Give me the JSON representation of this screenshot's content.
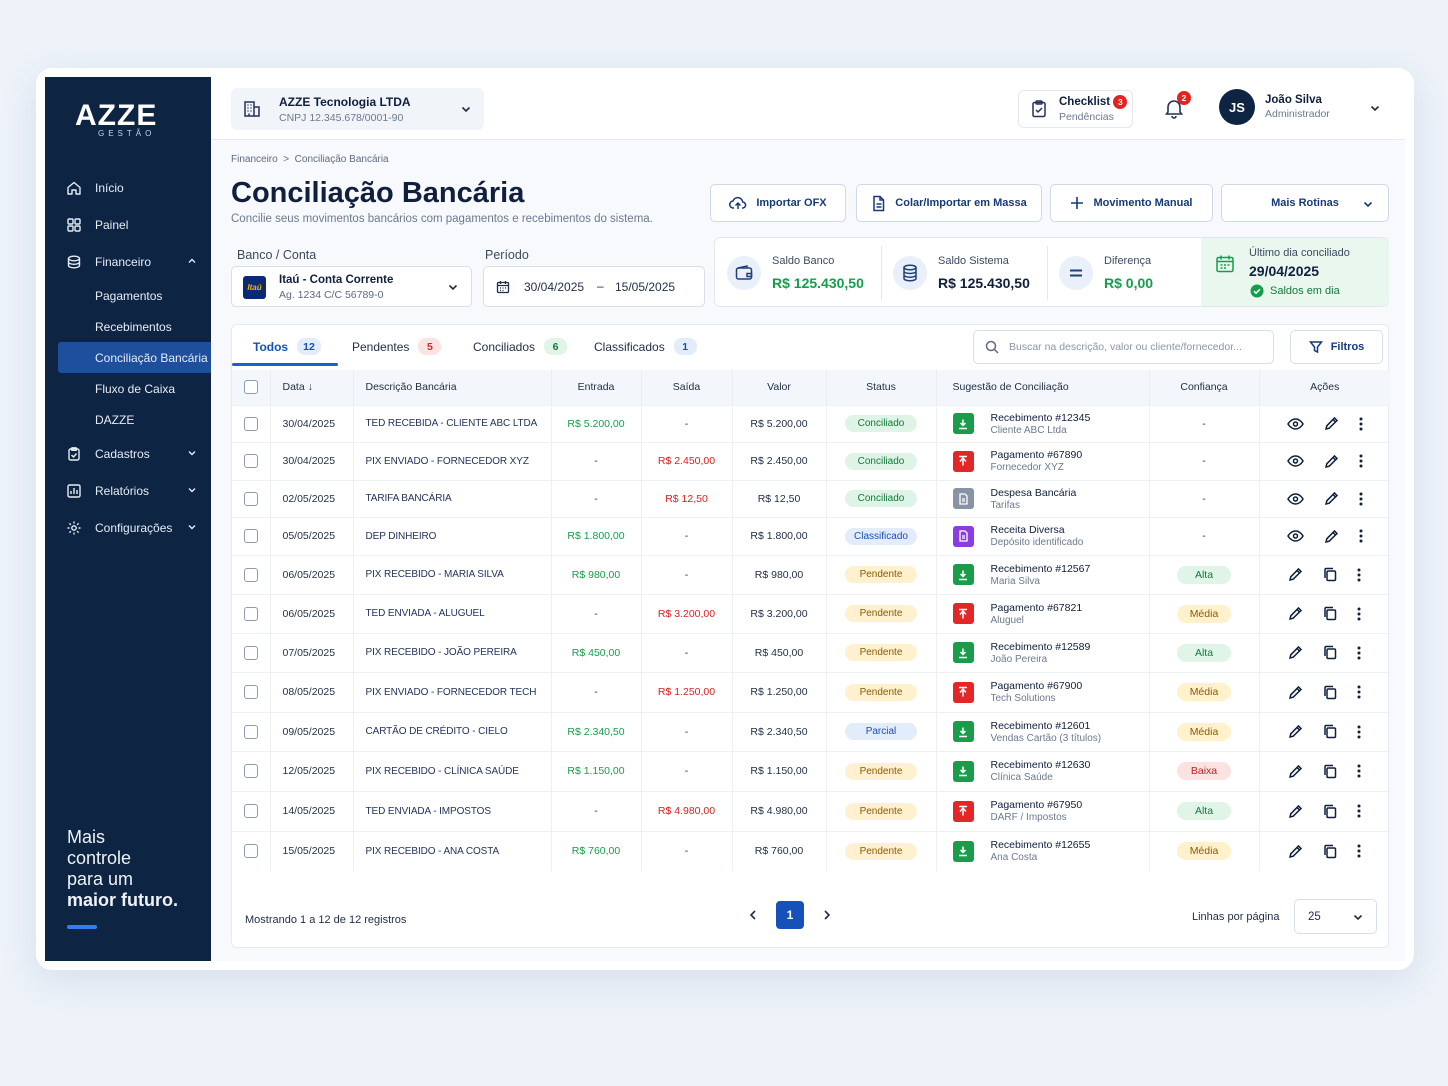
{
  "brand": {
    "logo": "AZZE",
    "logo_sub": "GESTÃO",
    "tagline_1": "Mais",
    "tagline_2": "controle",
    "tagline_3": "para um",
    "tagline_4": "maior futuro."
  },
  "sidebar": {
    "items": [
      {
        "label": "Início",
        "icon": "home-icon"
      },
      {
        "label": "Painel",
        "icon": "grid-icon"
      },
      {
        "label": "Financeiro",
        "icon": "coins-icon"
      }
    ],
    "financeiro_sub": [
      "Pagamentos",
      "Recebimentos",
      "Conciliação Bancária",
      "Fluxo de Caixa",
      "DAZZE"
    ],
    "items_after": [
      {
        "label": "Cadastros",
        "icon": "clipboard-icon"
      },
      {
        "label": "Relatórios",
        "icon": "chart-icon"
      },
      {
        "label": "Configurações",
        "icon": "gear-icon"
      }
    ]
  },
  "topbar": {
    "company_name": "AZZE Tecnologia LTDA",
    "company_cnpj": "CNPJ 12.345.678/0001-90",
    "checklist_title": "Checklist",
    "checklist_sub": "Pendências",
    "checklist_count": "3",
    "notif_count": "2",
    "user_initials": "JS",
    "user_name": "João Silva",
    "user_role": "Administrador"
  },
  "page": {
    "breadcrumb_1": "Financeiro",
    "breadcrumb_sep": ">",
    "breadcrumb_2": "Conciliação Bancária",
    "title": "Conciliação Bancária",
    "subtitle": "Concilie seus movimentos bancários com pagamentos e recebimentos do sistema."
  },
  "actions": {
    "import_ofx": "Importar OFX",
    "paste_import": "Colar/Importar em Massa",
    "manual": "Movimento Manual",
    "more": "Mais Rotinas"
  },
  "filters": {
    "bank_label": "Banco / Conta",
    "bank_logo": "Itaú",
    "bank_name": "Itaú - Conta Corrente",
    "bank_account": "Ag. 1234  C/C 56789-0",
    "period_label": "Período",
    "period_from": "30/04/2025",
    "period_sep": "–",
    "period_to": "15/05/2025"
  },
  "kpis": {
    "saldo_banco_label": "Saldo Banco",
    "saldo_banco": "R$ 125.430,50",
    "saldo_sistema_label": "Saldo Sistema",
    "saldo_sistema": "R$ 125.430,50",
    "diferenca_label": "Diferença",
    "diferenca": "R$ 0,00",
    "ultimo_label": "Último dia conciliado",
    "ultimo_date": "29/04/2025",
    "ultimo_status": "Saldos em dia"
  },
  "tabs": [
    {
      "label": "Todos",
      "count": "12"
    },
    {
      "label": "Pendentes",
      "count": "5"
    },
    {
      "label": "Conciliados",
      "count": "6"
    },
    {
      "label": "Classificados",
      "count": "1"
    }
  ],
  "search_placeholder": "Buscar na descrição, valor ou cliente/fornecedor...",
  "filtros_label": "Filtros",
  "table": {
    "headers": [
      "Data",
      "Descrição Bancária",
      "Entrada",
      "Saída",
      "Valor",
      "Status",
      "Sugestão de Conciliação",
      "Confiança",
      "Ações"
    ],
    "sort_arrow": "↓",
    "rows": [
      {
        "date": "30/04/2025",
        "desc": "TED RECEBIDA - CLIENTE ABC LTDA",
        "in": "R$ 5.200,00",
        "out": "-",
        "value": "R$ 5.200,00",
        "status": "Conciliado",
        "sug_title": "Recebimento #12345",
        "sug_sub": "Cliente ABC Ltda",
        "conf": "-"
      },
      {
        "date": "30/04/2025",
        "desc": "PIX ENVIADO - FORNECEDOR XYZ",
        "in": "-",
        "out": "R$ 2.450,00",
        "value": "R$ 2.450,00",
        "status": "Conciliado",
        "sug_title": "Pagamento #67890",
        "sug_sub": "Fornecedor XYZ",
        "conf": "-"
      },
      {
        "date": "02/05/2025",
        "desc": "TARIFA BANCÁRIA",
        "in": "-",
        "out": "R$ 12,50",
        "value": "R$ 12,50",
        "status": "Conciliado",
        "sug_title": "Despesa Bancária",
        "sug_sub": "Tarifas",
        "conf": "-"
      },
      {
        "date": "05/05/2025",
        "desc": "DEP DINHEIRO",
        "in": "R$ 1.800,00",
        "out": "-",
        "value": "R$ 1.800,00",
        "status": "Classificado",
        "sug_title": "Receita Diversa",
        "sug_sub": "Depósito identificado",
        "conf": "-"
      },
      {
        "date": "06/05/2025",
        "desc": "PIX RECEBIDO - MARIA SILVA",
        "in": "R$ 980,00",
        "out": "-",
        "value": "R$ 980,00",
        "status": "Pendente",
        "sug_title": "Recebimento #12567",
        "sug_sub": "Maria Silva",
        "conf": "Alta"
      },
      {
        "date": "06/05/2025",
        "desc": "TED ENVIADA - ALUGUEL",
        "in": "-",
        "out": "R$ 3.200,00",
        "value": "R$ 3.200,00",
        "status": "Pendente",
        "sug_title": "Pagamento #67821",
        "sug_sub": "Aluguel",
        "conf": "Média"
      },
      {
        "date": "07/05/2025",
        "desc": "PIX RECEBIDO - JOÃO PEREIRA",
        "in": "R$ 450,00",
        "out": "-",
        "value": "R$ 450,00",
        "status": "Pendente",
        "sug_title": "Recebimento #12589",
        "sug_sub": "João Pereira",
        "conf": "Alta"
      },
      {
        "date": "08/05/2025",
        "desc": "PIX ENVIADO - FORNECEDOR TECH",
        "in": "-",
        "out": "R$ 1.250,00",
        "value": "R$ 1.250,00",
        "status": "Pendente",
        "sug_title": "Pagamento #67900",
        "sug_sub": "Tech Solutions",
        "conf": "Média"
      },
      {
        "date": "09/05/2025",
        "desc": "CARTÃO DE CRÉDITO - CIELO",
        "in": "R$ 2.340,50",
        "out": "-",
        "value": "R$ 2.340,50",
        "status": "Parcial",
        "sug_title": "Recebimento #12601",
        "sug_sub": "Vendas Cartão (3 títulos)",
        "conf": "Média"
      },
      {
        "date": "12/05/2025",
        "desc": "PIX RECEBIDO - CLÍNICA SAÚDE",
        "in": "R$ 1.150,00",
        "out": "-",
        "value": "R$ 1.150,00",
        "status": "Pendente",
        "sug_title": "Recebimento #12630",
        "sug_sub": "Clínica Saúde",
        "conf": "Baixa"
      },
      {
        "date": "14/05/2025",
        "desc": "TED ENVIADA - IMPOSTOS",
        "in": "-",
        "out": "R$ 4.980,00",
        "value": "R$ 4.980,00",
        "status": "Pendente",
        "sug_title": "Pagamento #67950",
        "sug_sub": "DARF / Impostos",
        "conf": "Alta"
      },
      {
        "date": "15/05/2025",
        "desc": "PIX RECEBIDO - ANA COSTA",
        "in": "R$ 760,00",
        "out": "-",
        "value": "R$ 760,00",
        "status": "Pendente",
        "sug_title": "Recebimento #12655",
        "sug_sub": "Ana Costa",
        "conf": "Média"
      }
    ]
  },
  "footer": {
    "showing": "Mostrando 1 a 12 de 12 registros",
    "page": "1",
    "rows_label": "Linhas por página",
    "rows_value": "25"
  },
  "colors": {
    "sidebar": "#0e2443",
    "accent": "#1551b9",
    "green": "#139f4a",
    "red": "#dd1f1f"
  }
}
